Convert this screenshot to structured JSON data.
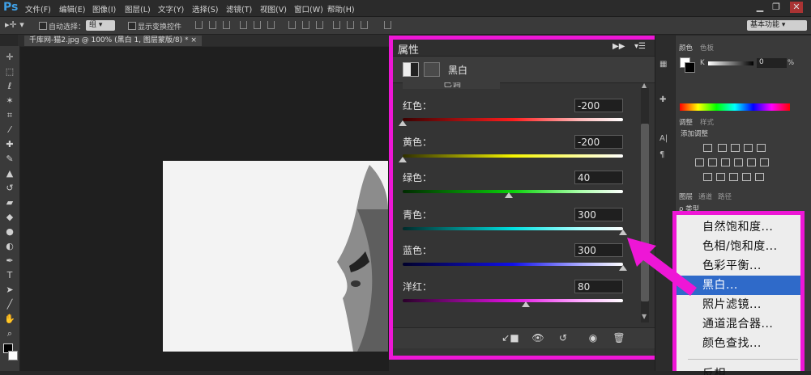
{
  "menubar": {
    "logo": "Ps",
    "items": [
      "文件(F)",
      "编辑(E)",
      "图像(I)",
      "图层(L)",
      "文字(Y)",
      "选择(S)",
      "滤镜(T)",
      "视图(V)",
      "窗口(W)",
      "帮助(H)"
    ]
  },
  "options": {
    "auto_select": "自动选择：",
    "group_value": "组",
    "show_transform": "显示变换控件",
    "workspace": "基本功能"
  },
  "document": {
    "tab": "千库网-猫2.jpg @ 100% (黑白 1, 图层蒙版/8) *"
  },
  "properties": {
    "title": "属性",
    "adjust_name": "黑白",
    "preset_cut": "已调",
    "sliders": [
      {
        "label": "红色：",
        "value": "-200",
        "fraction": 0.0
      },
      {
        "label": "黄色：",
        "value": "-200",
        "fraction": 0.0
      },
      {
        "label": "绿色：",
        "value": "40",
        "fraction": 0.48
      },
      {
        "label": "青色：",
        "value": "300",
        "fraction": 1.0
      },
      {
        "label": "蓝色：",
        "value": "300",
        "fraction": 1.0
      },
      {
        "label": "洋红：",
        "value": "80",
        "fraction": 0.56
      }
    ]
  },
  "right": {
    "color_tabs": [
      "颜色",
      "色板"
    ],
    "k_label": "K",
    "k_value": "0",
    "k_unit": "%",
    "adjust_tabs": [
      "调整",
      "样式"
    ],
    "add_adjust": "添加调整",
    "layer_tabs": [
      "图层",
      "通道",
      "路径"
    ],
    "kind_filter": "ρ 类型"
  },
  "adjust_menu": {
    "items": [
      "自然饱和度...",
      "色相/饱和度...",
      "色彩平衡...",
      "黑白...",
      "照片滤镜...",
      "通道混合器...",
      "颜色查找..."
    ],
    "selected_index": 3,
    "cut_item": "反相"
  },
  "colors": {
    "highlight": "#ee16d6",
    "selection": "#2f6ac9"
  }
}
